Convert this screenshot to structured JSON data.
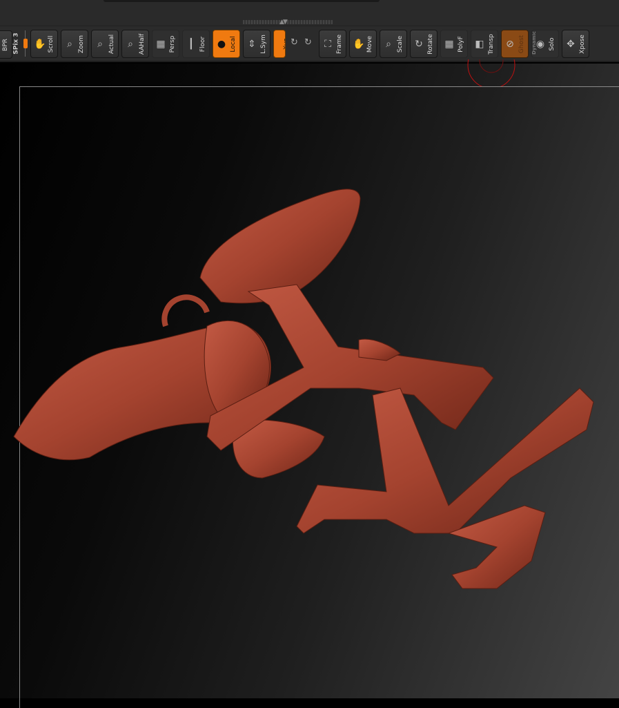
{
  "toolbar": {
    "bpr": "BPR",
    "spix": "SPix 3",
    "buttons": [
      {
        "label": "Scroll",
        "icon": "hand-icon"
      },
      {
        "label": "Zoom",
        "icon": "magnifier-icon"
      },
      {
        "label": "Actual",
        "icon": "magnifier-icon"
      },
      {
        "label": "AAHalf",
        "icon": "magnifier-icon"
      },
      {
        "label": "Persp",
        "icon": "grid-icon"
      },
      {
        "label": "Floor",
        "icon": "floor-icon"
      },
      {
        "label": "Local",
        "icon": "local-icon"
      },
      {
        "label": "L.Sym",
        "icon": "symmetry-icon"
      },
      {
        "label": "Xyz",
        "icon": "rotate-icon"
      },
      {
        "label": "Frame",
        "icon": "frame-icon"
      },
      {
        "label": "Move",
        "icon": "hand-icon"
      },
      {
        "label": "Scale",
        "icon": "magnifier-icon"
      },
      {
        "label": "Rotate",
        "icon": "rotate-icon"
      },
      {
        "label": "PolyF",
        "icon": "grid-icon"
      },
      {
        "label": "Transp",
        "icon": "transparency-icon"
      },
      {
        "label": "Ghost",
        "icon": "ghost-icon"
      },
      {
        "label": "Solo",
        "icon": "solo-icon"
      },
      {
        "label": "Xpose",
        "icon": "xpose-icon"
      }
    ],
    "dynamic": "Dynamic"
  },
  "colors": {
    "accent": "#f07a10",
    "model": "#a4432f"
  }
}
